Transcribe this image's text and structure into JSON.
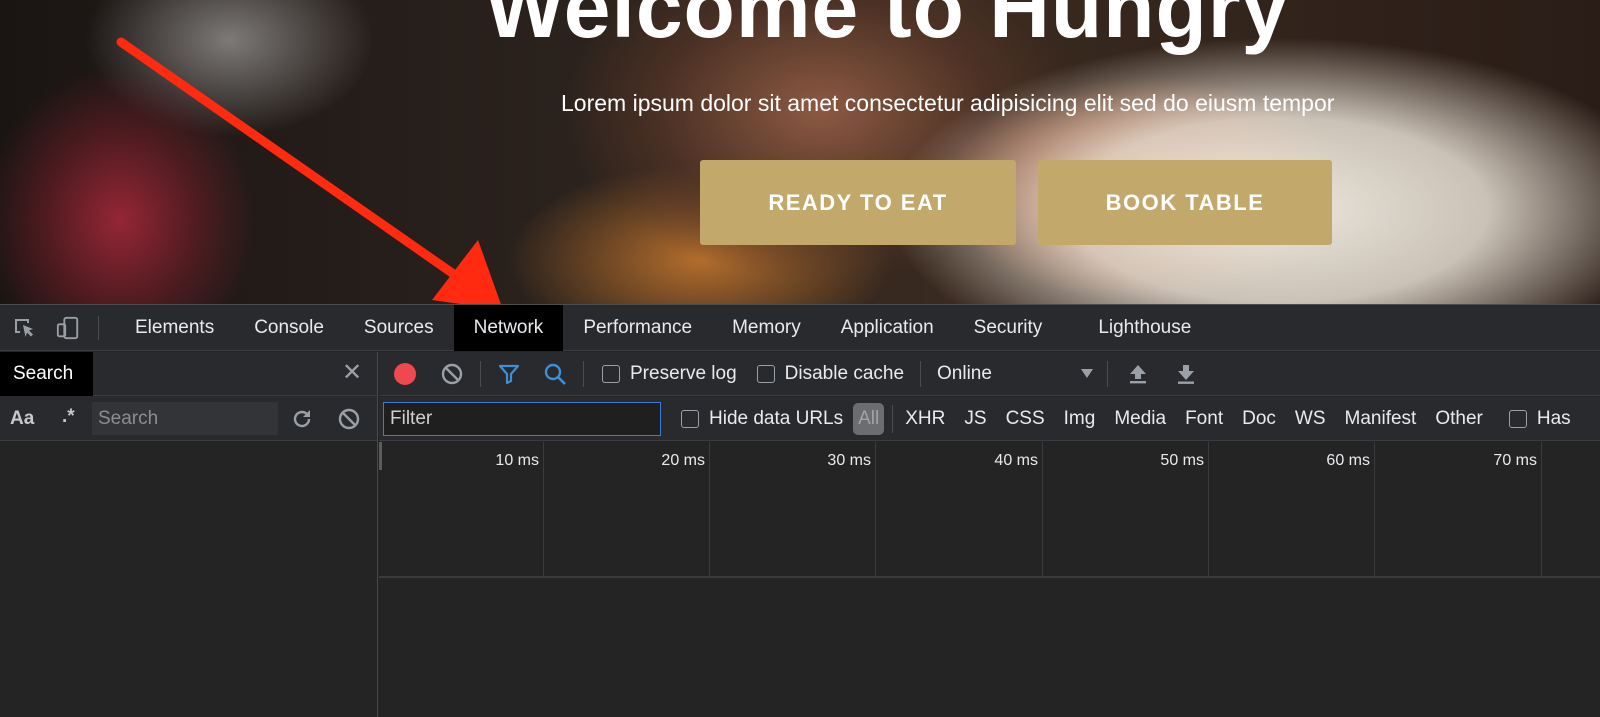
{
  "hero": {
    "title": "Welcome to Hungry",
    "subtitle": "Lorem ipsum dolor sit amet consectetur adipisicing elit sed do eiusm tempor",
    "buttons": [
      "READY TO EAT",
      "BOOK TABLE"
    ],
    "button_color": "#c2a86b",
    "annotation_arrow_color": "#ff2a10"
  },
  "devtools": {
    "tabs": [
      "Elements",
      "Console",
      "Sources",
      "Network",
      "Performance",
      "Memory",
      "Application",
      "Security",
      "Lighthouse"
    ],
    "active_tab": "Network",
    "search_pane": {
      "tab_label": "Search",
      "case_toggle": "Aa",
      "regex_toggle": ".*",
      "placeholder": "Search"
    },
    "network_toolbar": {
      "preserve_log": "Preserve log",
      "disable_cache": "Disable cache",
      "throttling": "Online",
      "record_color": "#f0484f",
      "accent_color": "#3d8fd6"
    },
    "filter_bar": {
      "placeholder": "Filter",
      "hide_data_urls": "Hide data URLs",
      "types": [
        "All",
        "XHR",
        "JS",
        "CSS",
        "Img",
        "Media",
        "Font",
        "Doc",
        "WS",
        "Manifest",
        "Other"
      ],
      "has_blocked": "Has"
    },
    "timeline_ticks": [
      "10 ms",
      "20 ms",
      "30 ms",
      "40 ms",
      "50 ms",
      "60 ms",
      "70 ms"
    ]
  }
}
